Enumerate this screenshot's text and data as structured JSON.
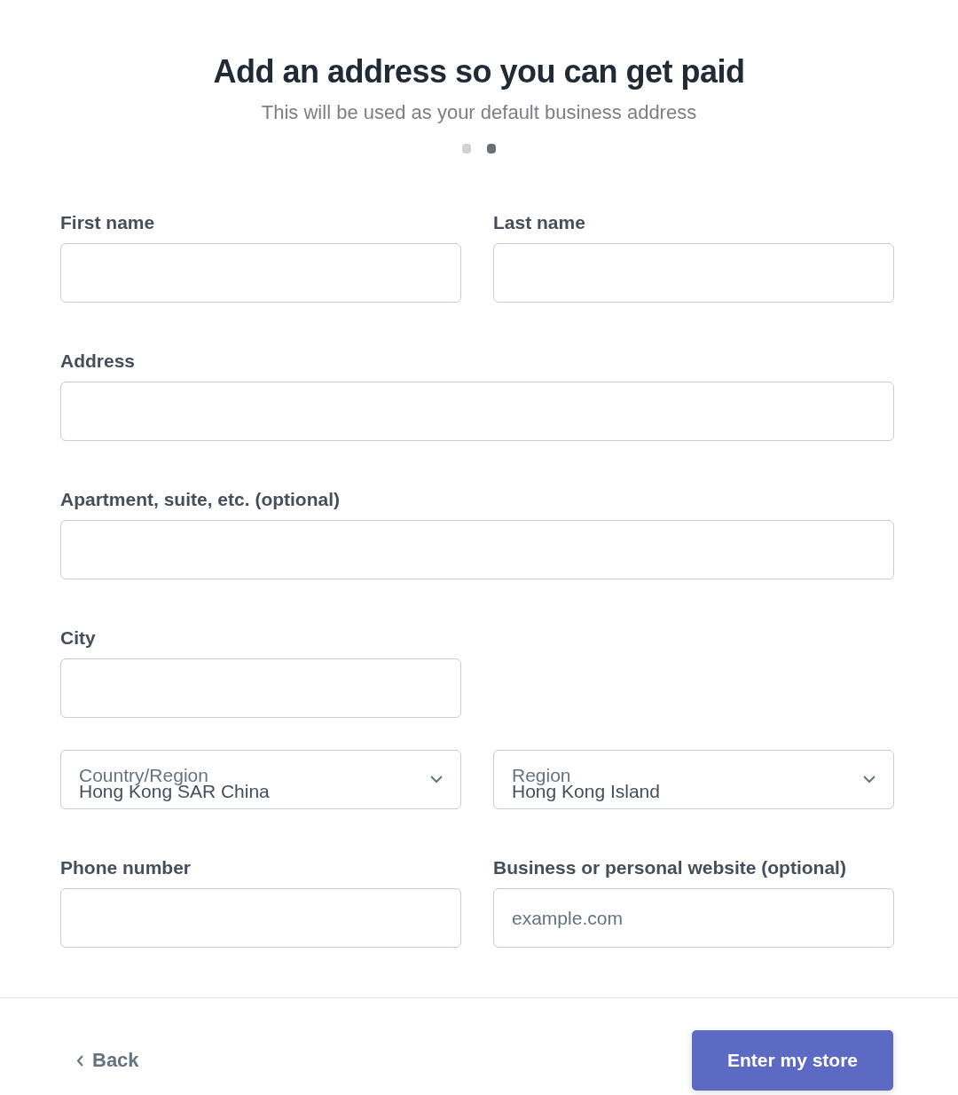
{
  "header": {
    "title": "Add an address so you can get paid",
    "subtitle": "This will be used as your default business address"
  },
  "steps": [
    {
      "selected": false
    },
    {
      "selected": true
    }
  ],
  "fields": [
    {
      "kind": "text",
      "label": "First name",
      "full_width": false
    },
    {
      "kind": "text",
      "label": "Last name",
      "full_width": false
    },
    {
      "kind": "text",
      "label": "Address",
      "full_width": true
    },
    {
      "kind": "text",
      "label": "Apartment, suite, etc. (optional)",
      "full_width": true
    },
    {
      "kind": "text",
      "label": "City",
      "full_width": false
    },
    {
      "kind": "spacer"
    },
    {
      "kind": "select",
      "label": "Country/Region",
      "value": "Hong Kong SAR China",
      "full_width": false
    },
    {
      "kind": "select",
      "label": "Region",
      "value": "Hong Kong Island",
      "full_width": false
    },
    {
      "kind": "text",
      "label": "Phone number",
      "full_width": false
    },
    {
      "kind": "text",
      "label": "Business or personal website (optional)",
      "placeholder": "example.com",
      "full_width": false
    }
  ],
  "footer": {
    "back": "Back",
    "submit": "Enter my store"
  }
}
